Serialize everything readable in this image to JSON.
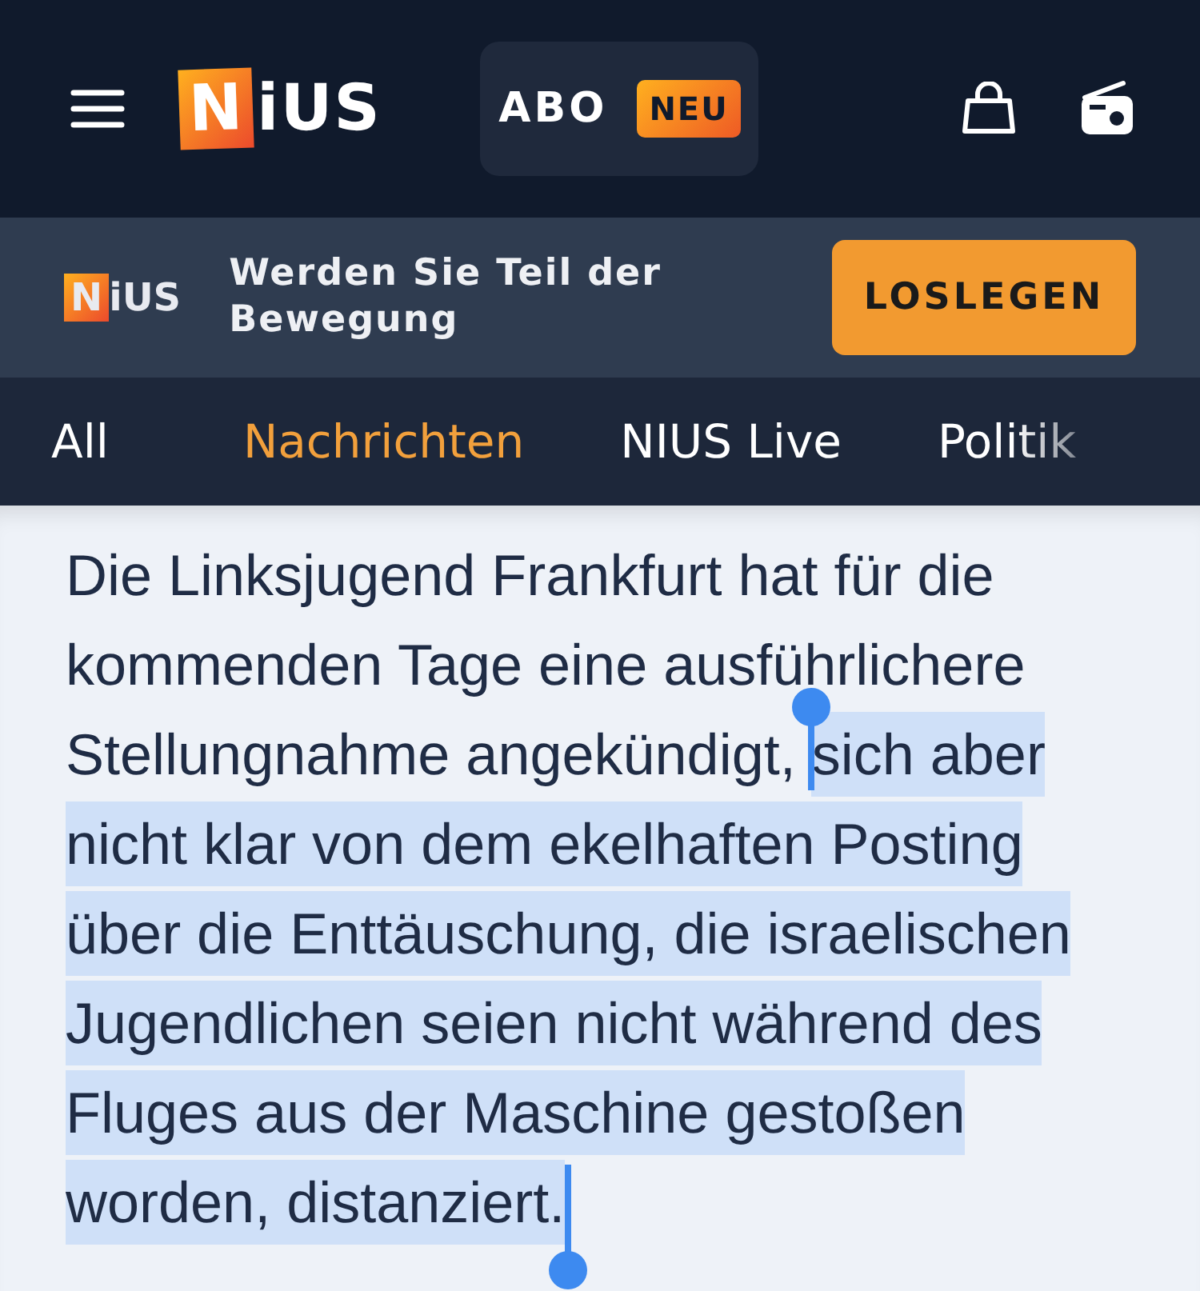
{
  "header": {
    "logo": "NiUS",
    "abo_button": {
      "label": "ABO",
      "badge": "NEU"
    }
  },
  "banner": {
    "logo": "NiUS",
    "text": "Werden Sie Teil der Bewegung",
    "button": "LOSLEGEN"
  },
  "tabs": [
    {
      "label": "All",
      "selected": false
    },
    {
      "label": "Nachrichten",
      "selected": true
    },
    {
      "label": "NIUS Live",
      "selected": false
    },
    {
      "label": "Politik",
      "selected": false
    }
  ],
  "article": {
    "text_before": "Die Linksjugend Frankfurt hat für die kommenden Tage eine ausführlichere Stellungnahme angekündigt, ",
    "selected_text": "sich aber nicht klar von dem ekelhaften Posting über die Enttäuschung, die israelischen Jugendlichen seien nicht während des Fluges aus der Maschine gestoßen worden, distanziert."
  }
}
